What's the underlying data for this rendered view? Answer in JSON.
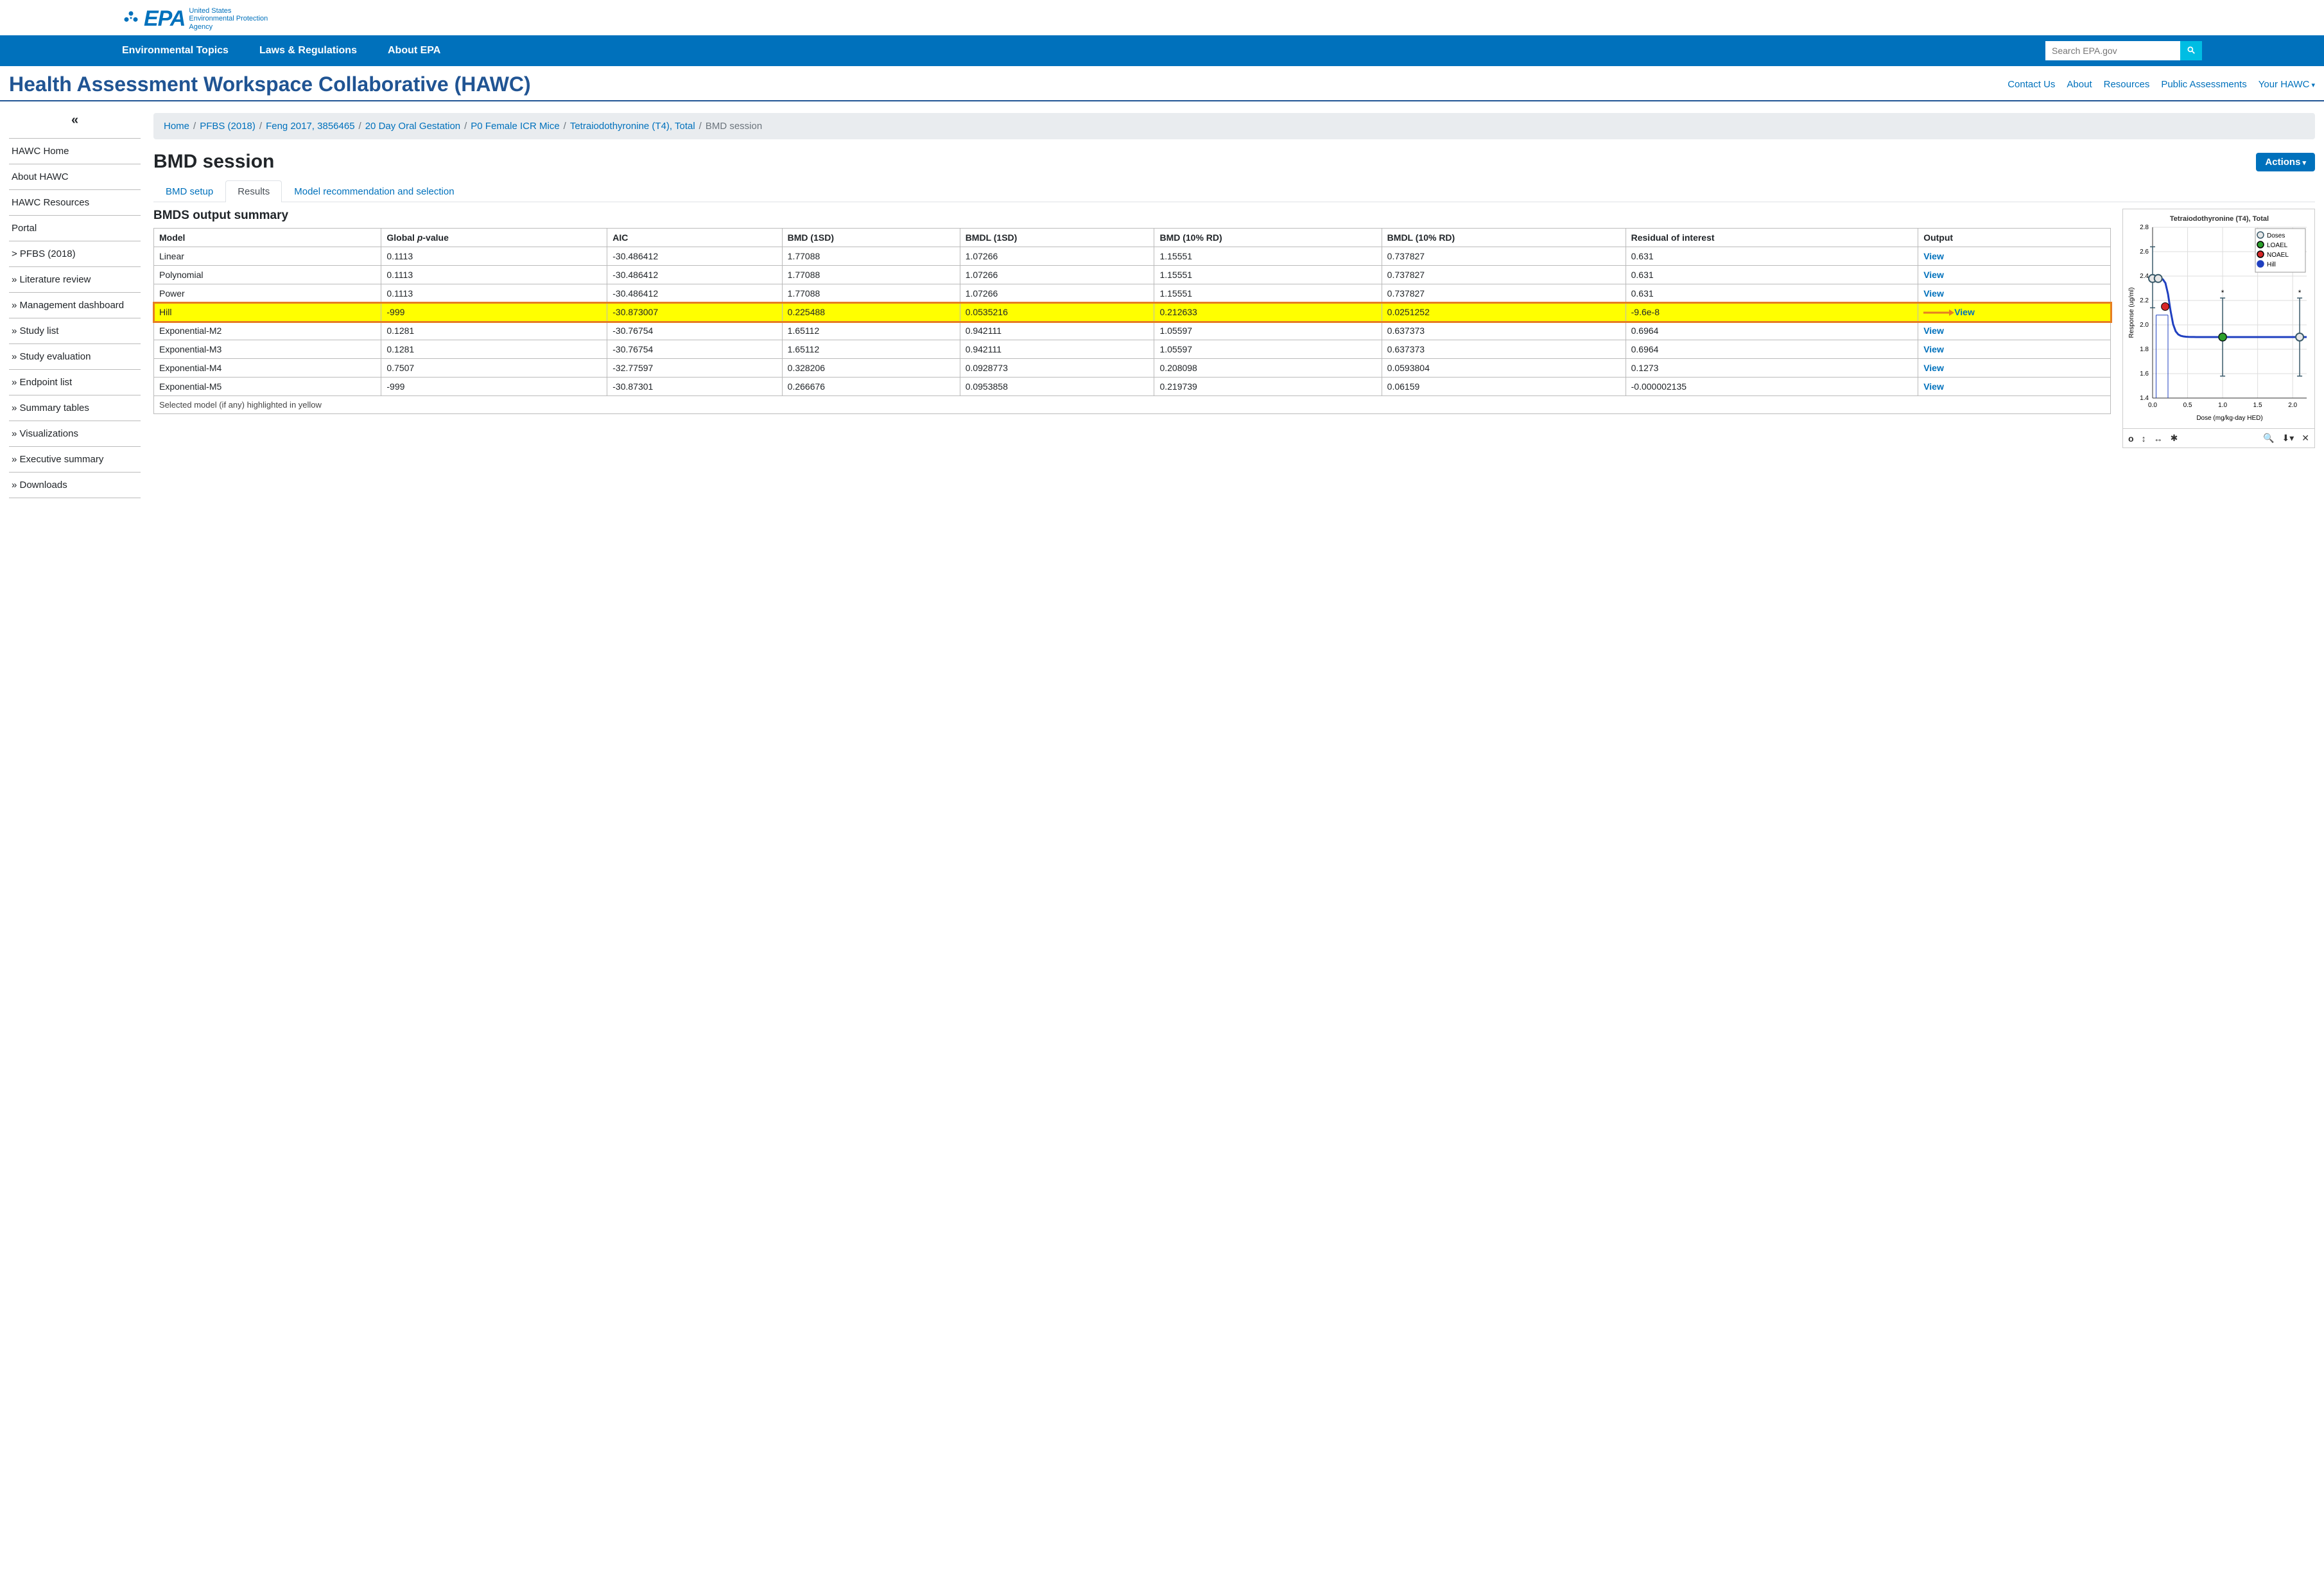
{
  "epa": {
    "acronym": "EPA",
    "full_name_l1": "United States",
    "full_name_l2": "Environmental Protection",
    "full_name_l3": "Agency"
  },
  "top_nav": {
    "items": [
      "Environmental Topics",
      "Laws & Regulations",
      "About EPA"
    ],
    "search_placeholder": "Search EPA.gov"
  },
  "app": {
    "title": "Health Assessment Workspace Collaborative (HAWC)",
    "links": [
      "Contact Us",
      "About",
      "Resources",
      "Public Assessments",
      "Your HAWC"
    ]
  },
  "sidebar": {
    "items": [
      {
        "label": "HAWC Home",
        "prefix": ""
      },
      {
        "label": "About HAWC",
        "prefix": ""
      },
      {
        "label": "HAWC Resources",
        "prefix": ""
      },
      {
        "label": "Portal",
        "prefix": ""
      },
      {
        "label": "PFBS (2018)",
        "prefix": "> "
      },
      {
        "label": "Literature review",
        "prefix": "» "
      },
      {
        "label": "Management dashboard",
        "prefix": "» "
      },
      {
        "label": "Study list",
        "prefix": "» "
      },
      {
        "label": "Study evaluation",
        "prefix": "» "
      },
      {
        "label": "Endpoint list",
        "prefix": "» "
      },
      {
        "label": "Summary tables",
        "prefix": "» "
      },
      {
        "label": "Visualizations",
        "prefix": "» "
      },
      {
        "label": "Executive summary",
        "prefix": "» "
      },
      {
        "label": "Downloads",
        "prefix": "» "
      }
    ]
  },
  "breadcrumb": {
    "items": [
      "Home",
      "PFBS (2018)",
      "Feng 2017, 3856465",
      "20 Day Oral Gestation",
      "P0 Female ICR Mice",
      "Tetraiodothyronine (T4), Total"
    ],
    "current": "BMD session"
  },
  "page": {
    "title": "BMD session",
    "actions_label": "Actions"
  },
  "tabs": {
    "items": [
      "BMD setup",
      "Results",
      "Model recommendation and selection"
    ],
    "active": 1
  },
  "summary": {
    "heading": "BMDS output summary",
    "headers": [
      "Model",
      "Global p-value",
      "AIC",
      "BMD (1SD)",
      "BMDL (1SD)",
      "BMD (10% RD)",
      "BMDL (10% RD)",
      "Residual of interest",
      "Output"
    ],
    "view_label": "View",
    "rows": [
      {
        "model": "Linear",
        "p": "0.1113",
        "aic": "-30.486412",
        "bmd1": "1.77088",
        "bmdl1": "1.07266",
        "bmd10": "1.15551",
        "bmdl10": "0.737827",
        "res": "0.631",
        "hl": false
      },
      {
        "model": "Polynomial",
        "p": "0.1113",
        "aic": "-30.486412",
        "bmd1": "1.77088",
        "bmdl1": "1.07266",
        "bmd10": "1.15551",
        "bmdl10": "0.737827",
        "res": "0.631",
        "hl": false
      },
      {
        "model": "Power",
        "p": "0.1113",
        "aic": "-30.486412",
        "bmd1": "1.77088",
        "bmdl1": "1.07266",
        "bmd10": "1.15551",
        "bmdl10": "0.737827",
        "res": "0.631",
        "hl": false
      },
      {
        "model": "Hill",
        "p": "-999",
        "aic": "-30.873007",
        "bmd1": "0.225488",
        "bmdl1": "0.0535216",
        "bmd10": "0.212633",
        "bmdl10": "0.0251252",
        "res": "-9.6e-8",
        "hl": true
      },
      {
        "model": "Exponential-M2",
        "p": "0.1281",
        "aic": "-30.76754",
        "bmd1": "1.65112",
        "bmdl1": "0.942111",
        "bmd10": "1.05597",
        "bmdl10": "0.637373",
        "res": "0.6964",
        "hl": false
      },
      {
        "model": "Exponential-M3",
        "p": "0.1281",
        "aic": "-30.76754",
        "bmd1": "1.65112",
        "bmdl1": "0.942111",
        "bmd10": "1.05597",
        "bmdl10": "0.637373",
        "res": "0.6964",
        "hl": false
      },
      {
        "model": "Exponential-M4",
        "p": "0.7507",
        "aic": "-32.77597",
        "bmd1": "0.328206",
        "bmdl1": "0.0928773",
        "bmd10": "0.208098",
        "bmdl10": "0.0593804",
        "res": "0.1273",
        "hl": false
      },
      {
        "model": "Exponential-M5",
        "p": "-999",
        "aic": "-30.87301",
        "bmd1": "0.266676",
        "bmdl1": "0.0953858",
        "bmd10": "0.219739",
        "bmdl10": "0.06159",
        "res": "-0.000002135",
        "hl": false
      }
    ],
    "footer": "Selected model (if any) highlighted in yellow"
  },
  "chart_data": {
    "type": "scatter",
    "title": "Tetraiodothyronine (T4), Total",
    "xlabel": "Dose (mg/kg-day HED)",
    "ylabel": "Response (ug/ml)",
    "xlim": [
      0.0,
      2.2
    ],
    "ylim": [
      1.4,
      2.8
    ],
    "xticks": [
      0.0,
      0.5,
      1.0,
      1.5,
      2.0
    ],
    "yticks": [
      1.4,
      1.6,
      1.8,
      2.0,
      2.2,
      2.4,
      2.6,
      2.8
    ],
    "legend": [
      "Doses",
      "LOAEL",
      "NOAEL",
      "Hill"
    ],
    "series": [
      {
        "name": "Doses",
        "points": [
          {
            "x": 0.0,
            "y": 2.38,
            "err": [
              2.14,
              2.64
            ]
          },
          {
            "x": 0.08,
            "y": 2.38
          },
          {
            "x": 1.0,
            "y": 1.9,
            "err": [
              1.58,
              2.22
            ],
            "star": true
          },
          {
            "x": 2.1,
            "y": 1.9,
            "err": [
              1.58,
              2.22
            ],
            "star": true
          }
        ]
      },
      {
        "name": "NOAEL",
        "points": [
          {
            "x": 0.18,
            "y": 2.15
          }
        ]
      },
      {
        "name": "LOAEL",
        "points": [
          {
            "x": 1.0,
            "y": 1.9
          }
        ]
      },
      {
        "name": "Hill",
        "curve_point": {
          "x": 0.25,
          "y_from": 2.38,
          "y_to": 1.9
        }
      }
    ],
    "bmd_lines": {
      "bmdl_x": 0.05,
      "bmd_x": 0.22,
      "ref_y": 2.08
    }
  }
}
